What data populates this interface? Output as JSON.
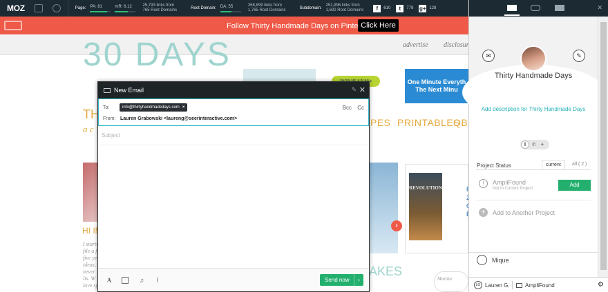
{
  "mozbar": {
    "logo": "MOZ",
    "page_label": "Page:",
    "pa": "PA: 81",
    "mr": "mR: 6.12",
    "page_links_1": "25,793 links from",
    "page_links_2": "765 Root Domains",
    "root_label": "Root Domain:",
    "da": "DA: 55",
    "root_links_1": "268,899 links from",
    "root_links_2": "1,765 Root Domains",
    "sub_label": "Subdomain:",
    "sub_links_1": "251,996 links from",
    "sub_links_2": "1,692 Root Domains",
    "social": [
      {
        "icon": "f",
        "count": "610"
      },
      {
        "icon": "t",
        "count": "779"
      },
      {
        "icon": "g+",
        "count": "128"
      }
    ],
    "pa_level": 0.81,
    "mr_level": 0.61,
    "da_level": 0.55
  },
  "banner": {
    "message": "Follow Thirty Handmade Days on Pinterest",
    "button": "Click Here"
  },
  "site": {
    "nav": [
      "advertise",
      "disclosur"
    ],
    "logo": "30 DAYS",
    "thi": "THI",
    "crumb": "a c",
    "ad_button": "SHOW ME A PLAN ▸",
    "ad_blue": "One Minute Everyth The Next Minu",
    "menu": [
      "PES",
      "PRINTABLES",
      "QBM"
    ],
    "hi_text": "HI IM",
    "italic_lines": [
      "I startu",
      "file a f",
      "five ye",
      "ideas,",
      "never",
      "lis. W",
      "love sp"
    ],
    "movie_title": "REVOLUTION",
    "movie_links": [
      "R",
      "2",
      "C",
      "B"
    ],
    "cakes": "AKES",
    "martha": "Martha"
  },
  "compose": {
    "title": "New Email",
    "to_label": "To:",
    "to_chip": "info@thirtyhandmadedays.com",
    "bcc": "Bcc",
    "cc": "Cc",
    "from_label": "From:",
    "from_value": "Lauren Grabowski <laureng@seerinteractive.com>",
    "subject_placeholder": "Subject",
    "send": "Send now"
  },
  "sidebar": {
    "name": "Thirty Handmade Days",
    "description": "Add description for Thirty Handmade Days",
    "project_status": "Project Status",
    "tab_current": "current",
    "tab_all": "all ( 2 )",
    "ampli_name": "AmpliFound",
    "ampli_sub": "Not In Current Project",
    "add": "Add",
    "add_another": "Add to Another Project",
    "person": "Mique",
    "footer_initials": "LG",
    "footer_user": "Lauren G.",
    "footer_project": "AmpliFound"
  }
}
